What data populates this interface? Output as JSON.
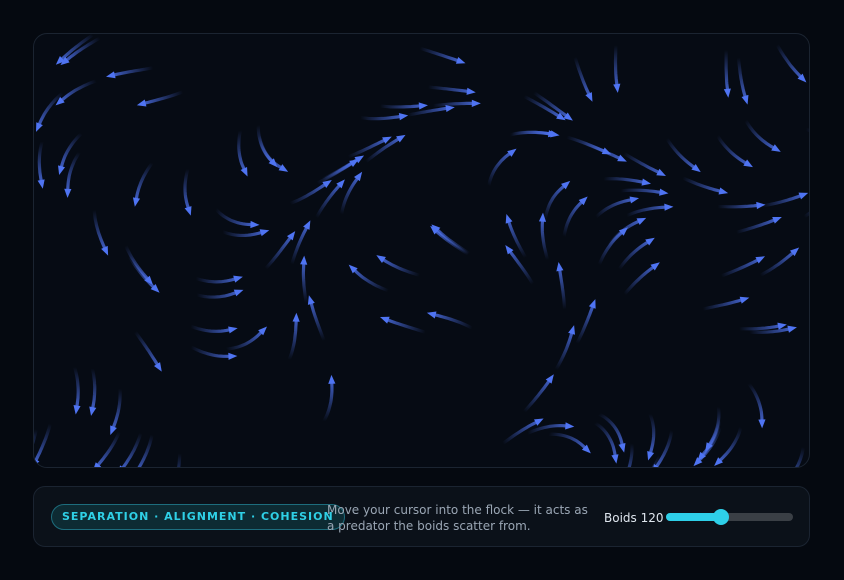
{
  "controls": {
    "badge_label": "SEPARATION · ALIGNMENT · COHESION",
    "hint_text": "Move your cursor into the flock — it acts as a predator the boids scatter from.",
    "boids_label": "Boids",
    "boids_count": "120",
    "boids_fraction": 0.43
  },
  "colors": {
    "boid": "#4f74f2",
    "accent": "#2ecfe8"
  }
}
